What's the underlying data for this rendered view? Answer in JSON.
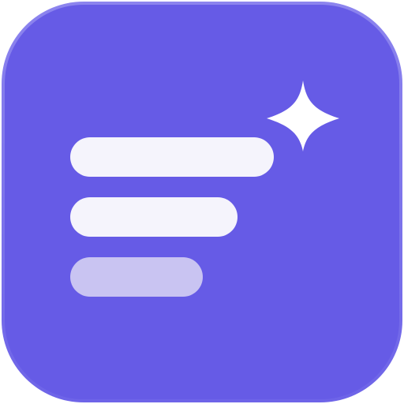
{
  "icon": {
    "name": "app-icon",
    "glyph": "text-lines-with-sparkle",
    "colors": {
      "background": "#665BE6",
      "background_edge": "#7B72EA",
      "line_primary": "#F5F4FC",
      "line_muted": "#C9C4F2",
      "sparkle": "#FFFFFF"
    }
  }
}
